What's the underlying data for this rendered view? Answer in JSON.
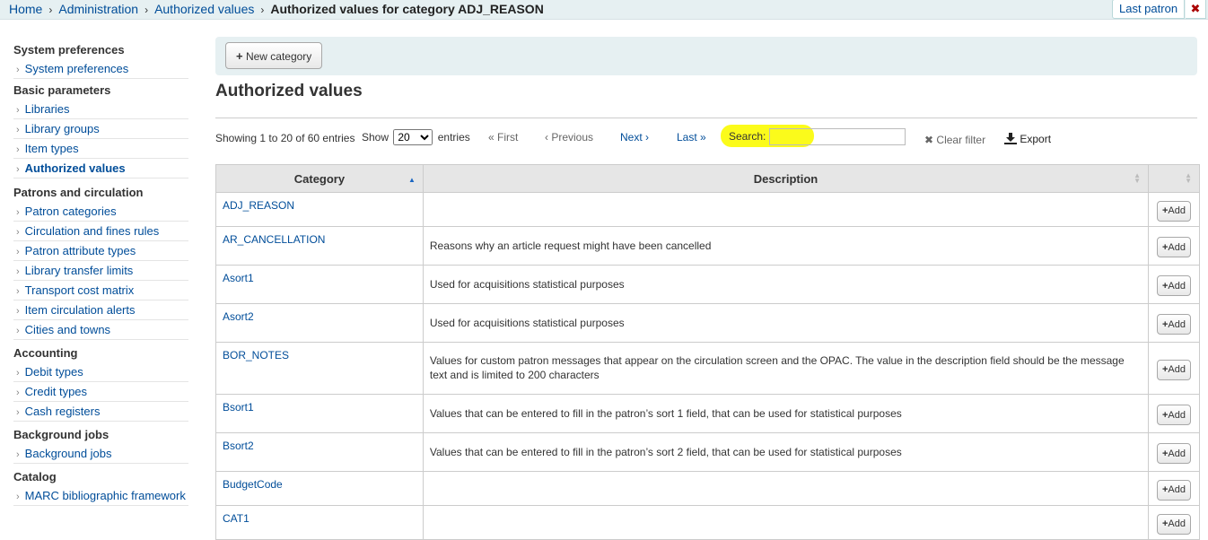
{
  "breadcrumb": {
    "items": [
      "Home",
      "Administration",
      "Authorized values"
    ],
    "current": "Authorized values for category ADJ_REASON"
  },
  "header": {
    "last_patron": "Last patron",
    "close": "✖"
  },
  "sidebar": {
    "sections": [
      {
        "heading": "System preferences",
        "items": [
          "System preferences"
        ]
      },
      {
        "heading": "Basic parameters",
        "items": [
          "Libraries",
          "Library groups",
          "Item types",
          "Authorized values"
        ]
      },
      {
        "heading": "Patrons and circulation",
        "items": [
          "Patron categories",
          "Circulation and fines rules",
          "Patron attribute types",
          "Library transfer limits",
          "Transport cost matrix",
          "Item circulation alerts",
          "Cities and towns"
        ]
      },
      {
        "heading": "Accounting",
        "items": [
          "Debit types",
          "Credit types",
          "Cash registers"
        ]
      },
      {
        "heading": "Background jobs",
        "items": [
          "Background jobs"
        ]
      },
      {
        "heading": "Catalog",
        "items": [
          "MARC bibliographic framework"
        ]
      }
    ],
    "active": "Authorized values"
  },
  "toolbar": {
    "new_category": "New category"
  },
  "page_title": "Authorized values",
  "table_controls": {
    "info": "Showing 1 to 20 of 60 entries",
    "show_label": "Show",
    "show_value": "20",
    "entries_label": "entries",
    "first": "« First",
    "previous": "‹ Previous",
    "next": "Next ›",
    "last": "Last »",
    "search_label": "Search:",
    "search_value": "",
    "clear_filter": "Clear filter",
    "export": "Export"
  },
  "table": {
    "columns": [
      "Category",
      "Description",
      ""
    ],
    "add_label": "Add",
    "rows": [
      {
        "category": "ADJ_REASON",
        "description": ""
      },
      {
        "category": "AR_CANCELLATION",
        "description": "Reasons why an article request might have been cancelled"
      },
      {
        "category": "Asort1",
        "description": "Used for acquisitions statistical purposes"
      },
      {
        "category": "Asort2",
        "description": "Used for acquisitions statistical purposes"
      },
      {
        "category": "BOR_NOTES",
        "description": "Values for custom patron messages that appear on the circulation screen and the OPAC. The value in the description field should be the message text and is limited to 200 characters"
      },
      {
        "category": "Bsort1",
        "description": "Values that can be entered to fill in the patron’s sort 1 field, that can be used for statistical purposes"
      },
      {
        "category": "Bsort2",
        "description": "Values that can be entered to fill in the patron’s sort 2 field, that can be used for statistical purposes"
      },
      {
        "category": "BudgetCode",
        "description": ""
      },
      {
        "category": "CAT1",
        "description": ""
      }
    ]
  },
  "colors": {
    "link": "#004d99",
    "toolbar_bg": "#e6f0f2",
    "highlight": "#fbfb1b"
  }
}
